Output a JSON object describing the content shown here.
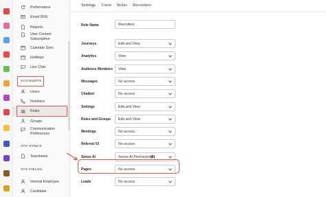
{
  "breadcrumb": [
    "Settings",
    "Users",
    "Roles",
    "Recruiters"
  ],
  "sidebar": {
    "items": [
      {
        "label": "Performance",
        "icon": "refresh-icon"
      },
      {
        "label": "Email DNS",
        "icon": "mail-icon"
      },
      {
        "label": "Reports",
        "icon": "file-icon"
      },
      {
        "label": "User Content",
        "label2": "Subscription",
        "icon": "file-icon"
      },
      {
        "label": "Calendar Sync",
        "icon": "calendar-icon"
      },
      {
        "label": "Holidays",
        "icon": "calendar-icon"
      },
      {
        "label": "Live Chat",
        "icon": "chat-icon"
      }
    ],
    "accounts_heading": "ACCOUNTS",
    "accounts_items": [
      {
        "label": "Users",
        "icon": "user-icon"
      },
      {
        "label": "Numbers",
        "icon": "phone-icon"
      },
      {
        "label": "Roles",
        "icon": "users-icon"
      },
      {
        "label": "Groups",
        "icon": "group-icon"
      },
      {
        "label": "Communication",
        "label2": "Preferences",
        "icon": "chat-icon"
      }
    ],
    "ats_syncs_heading": "ATS SYNCS",
    "ats_syncs_items": [
      {
        "label": "Tearsheets",
        "icon": "file-icon"
      }
    ],
    "ats_fields_heading": "ATS FIELDS",
    "ats_fields_items": [
      {
        "label": "Internal Employee",
        "icon": "user-icon"
      },
      {
        "label": "Candidate",
        "icon": "user-icon"
      }
    ]
  },
  "form": {
    "role_name_label": "Role Name",
    "role_name_value": "Recruiters",
    "rows": [
      {
        "label": "Journeys",
        "value": "Edit and View"
      },
      {
        "label": "Analytics",
        "value": "View"
      },
      {
        "label": "Audience Members",
        "value": "View"
      },
      {
        "label": "Messages",
        "value": "No access"
      },
      {
        "label": "Chatbot",
        "value": "No access"
      },
      {
        "label": "Settings",
        "value": "Edit and View"
      },
      {
        "label": "Roles and Groups",
        "value": "Edit and View"
      },
      {
        "label": "Meetings",
        "value": "No access"
      },
      {
        "label": "Referral V2",
        "value": "No access"
      },
      {
        "label": "Sense AI",
        "value": "Sense AI Permissions",
        "badge": "(5)"
      },
      {
        "label": "Pages",
        "value": "No access"
      },
      {
        "label": "Leads",
        "value": "No access"
      }
    ]
  },
  "colors": {
    "highlight": "#d9534f",
    "active_bg": "#e8e8e8"
  }
}
